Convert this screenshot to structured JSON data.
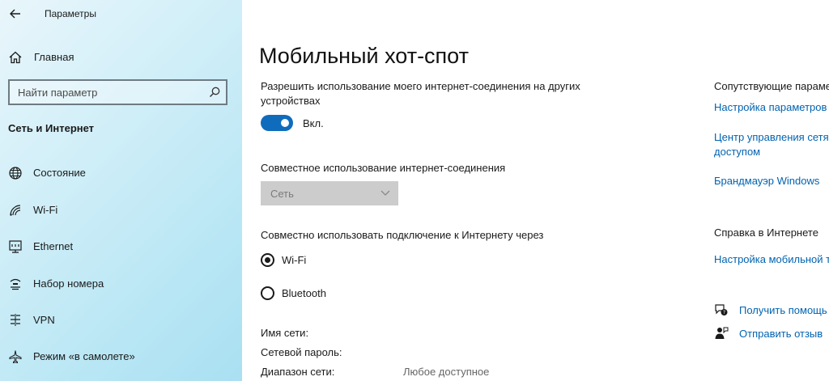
{
  "window": {
    "title": "Параметры"
  },
  "sidebar": {
    "home_label": "Главная",
    "search_placeholder": "Найти параметр",
    "section_title": "Сеть и Интернет",
    "items": [
      {
        "label": "Состояние",
        "icon": "globe-icon"
      },
      {
        "label": "Wi-Fi",
        "icon": "wifi-icon"
      },
      {
        "label": "Ethernet",
        "icon": "ethernet-icon"
      },
      {
        "label": "Набор номера",
        "icon": "dialup-icon"
      },
      {
        "label": "VPN",
        "icon": "vpn-icon"
      },
      {
        "label": "Режим «в самолете»",
        "icon": "airplane-icon"
      }
    ]
  },
  "main": {
    "title": "Мобильный хот-спот",
    "share_label": "Разрешить использование моего интернет-соединения на других устройствах",
    "toggle_state": "Вкл.",
    "connection_label": "Совместное использование интернет-соединения",
    "connection_select": "Сеть",
    "share_via_label": "Совместно использовать подключение к Интернету через",
    "share_via_options": [
      {
        "label": "Wi-Fi",
        "selected": true
      },
      {
        "label": "Bluetooth",
        "selected": false
      }
    ],
    "network_name_label": "Имя сети:",
    "network_password_label": "Сетевой пароль:",
    "network_band_label": "Диапазон сети:",
    "network_band_value": "Любое доступное"
  },
  "related": {
    "title": "Сопутствующие параме",
    "links": [
      "Настройка параметров",
      "Центр управления сетя",
      "доступом",
      "Брандмауэр Windows"
    ],
    "web_help_title": "Справка в Интернете",
    "web_help_link": "Настройка мобильной т",
    "get_help": "Получить помощь",
    "send_feedback": "Отправить отзыв"
  },
  "colors": {
    "accent": "#0f6cbd",
    "link": "#0063b1",
    "sidebar": "#b8e6f4"
  }
}
